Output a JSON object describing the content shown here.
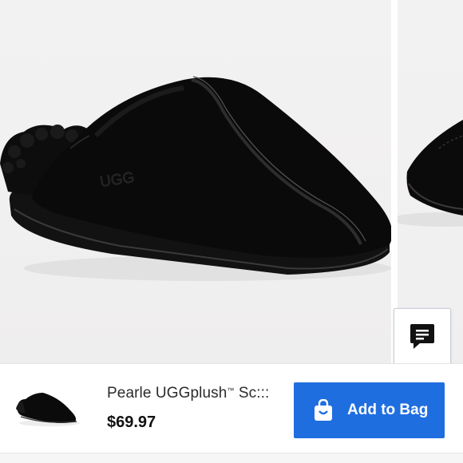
{
  "product": {
    "image_alt": "Black suede slide slipper with shearling collar",
    "logo_text": "UGG",
    "title": "Pearle UGGplush",
    "trademark": "™",
    "title_suffix": " Sc:::",
    "price": "$69.97"
  },
  "actions": {
    "add_to_bag_label": "Add to Bag",
    "add_to_bag_icon": "shopping-bag-icon",
    "chat_icon": "chat-bubble-icon"
  },
  "colors": {
    "accent": "#1f6ee0",
    "image_background": "#f1f0f0",
    "product": "#0b0b0b"
  }
}
